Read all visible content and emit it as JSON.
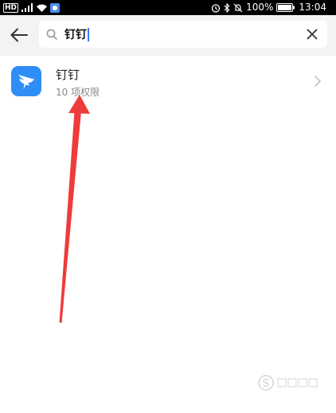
{
  "status_bar": {
    "network_label": "HD",
    "battery_percent": "100%",
    "time": "13:04"
  },
  "search": {
    "query": "钉钉"
  },
  "results": [
    {
      "name": "钉钉",
      "subtitle": "10 项权限"
    }
  ],
  "colors": {
    "accent": "#3a7bff",
    "app_icon_bg": "#2f8ef5",
    "annotation_arrow": "#ee3b3b"
  },
  "icons": {
    "back": "arrow-left-icon",
    "search": "search-icon",
    "clear": "close-icon",
    "chevron": "chevron-right-icon",
    "app": "dingtalk-app-icon"
  }
}
